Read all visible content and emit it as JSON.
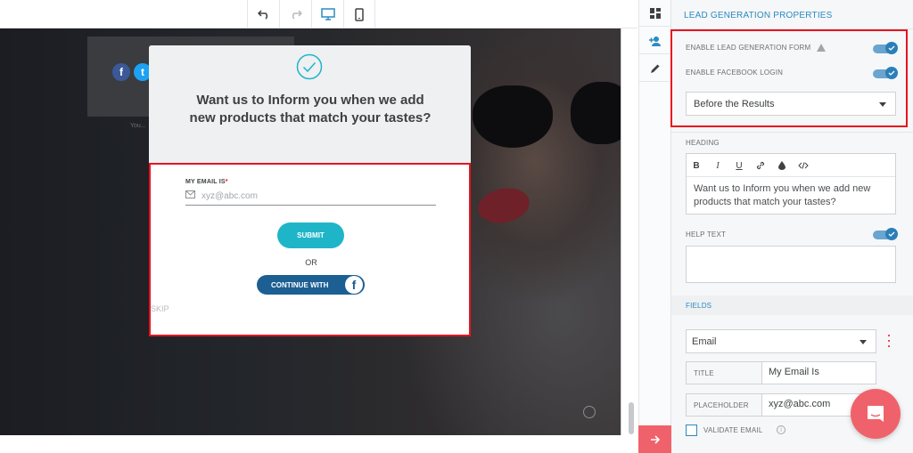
{
  "toolbar": {
    "buttons": [
      {
        "name": "undo",
        "icon": "undo-icon"
      },
      {
        "name": "redo",
        "icon": "redo-icon"
      },
      {
        "name": "desktop",
        "icon": "desktop-icon"
      },
      {
        "name": "mobile",
        "icon": "mobile-icon"
      }
    ]
  },
  "canvas": {
    "background_caption": "You...",
    "modal": {
      "title": "Want us to Inform you when we add new products that match your tastes?",
      "email_label": "MY EMAIL IS",
      "required_mark": "*",
      "email_placeholder": "xyz@abc.com",
      "submit_label": "SUBMIT",
      "or_text": "OR",
      "facebook_label": "CONTINUE WITH",
      "facebook_glyph": "f",
      "skip_label": "SKIP"
    }
  },
  "panel": {
    "title": "LEAD GENERATION PROPERTIES",
    "enable_form_label": "ENABLE LEAD GENERATION FORM",
    "enable_form_on": true,
    "enable_facebook_label": "ENABLE FACEBOOK LOGIN",
    "enable_facebook_on": true,
    "timing_value": "Before the Results",
    "heading_label": "HEADING",
    "heading_text": "Want us to Inform you when we add new products that match your tastes?",
    "editor_buttons": [
      "B",
      "I",
      "U"
    ],
    "help_text_label": "HELP TEXT",
    "help_text_on": true,
    "fields_title": "FIELDS",
    "field_type": "Email",
    "title_key": "TITLE",
    "title_value": "My Email Is",
    "placeholder_key": "PLACEHOLDER",
    "placeholder_value": "xyz@abc.com",
    "validate_label": "VALIDATE EMAIL",
    "info_glyph": "i"
  },
  "colors": {
    "accent": "#2b8ac2",
    "submit": "#1fb5c9",
    "facebook": "#1b5f93",
    "highlight": "#e8131f",
    "chat": "#f0626b"
  }
}
